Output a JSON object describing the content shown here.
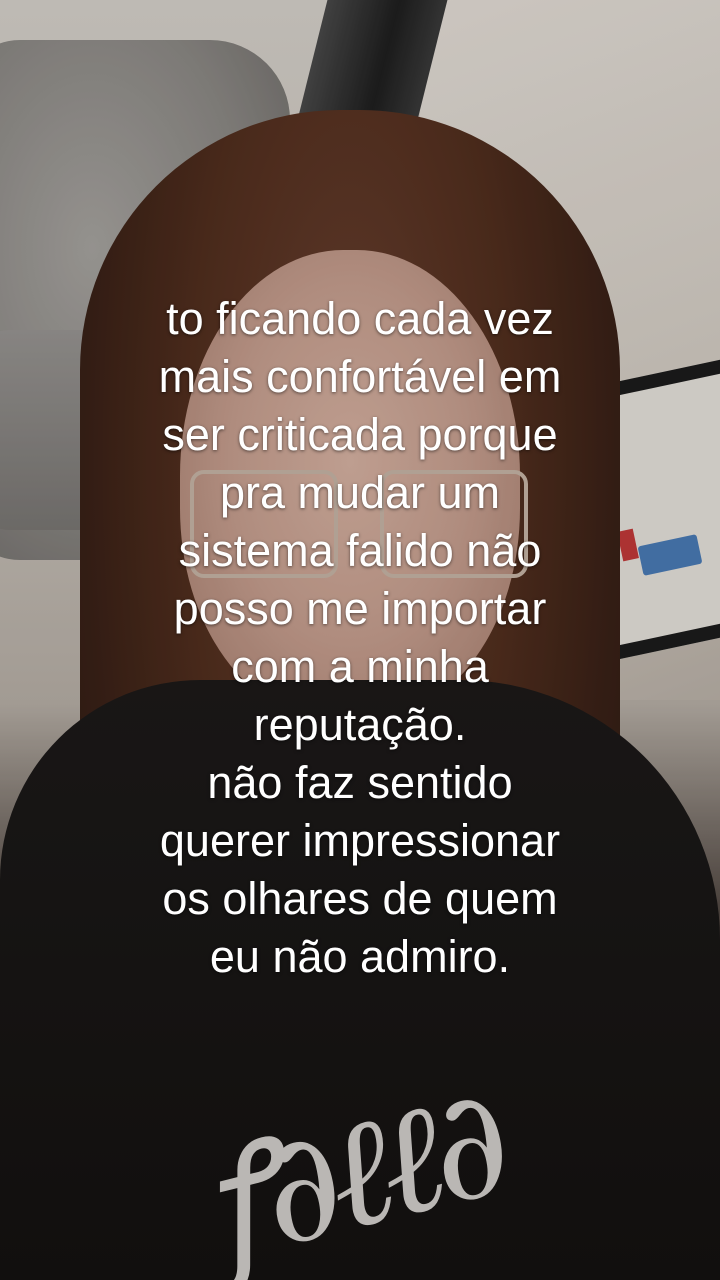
{
  "caption_lines": [
    "to ficando cada vez",
    "mais confortável em",
    "ser criticada porque",
    "pra mudar um",
    "sistema falido não",
    "posso me importar",
    "com a minha",
    "reputação.",
    "não faz sentido",
    "querer impressionar",
    "os olhares de quem",
    "eu não admiro."
  ],
  "colors": {
    "caption": "#ffffff",
    "hair": "#54301f",
    "shirt": "#1d1a19",
    "wall": "#d9d4cd"
  }
}
